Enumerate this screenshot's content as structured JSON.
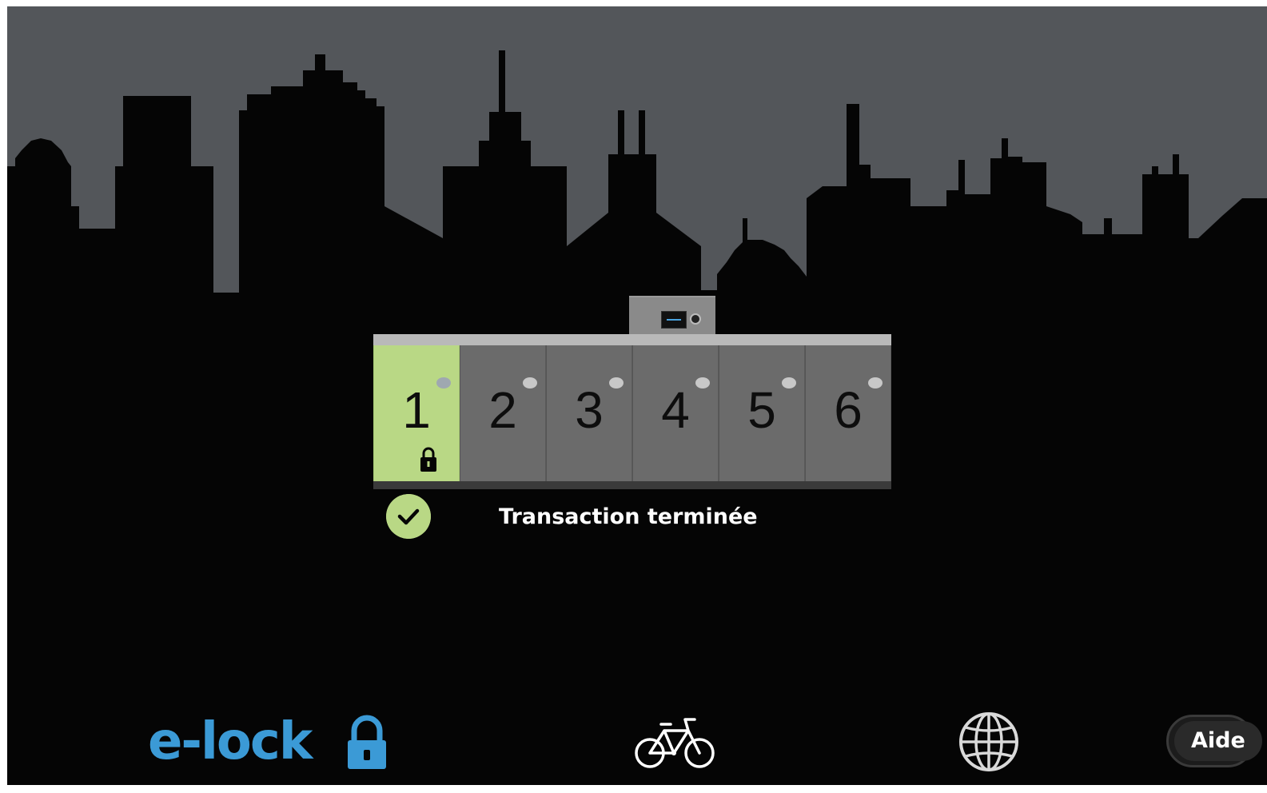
{
  "locker": {
    "doors": [
      {
        "number": "1",
        "state": "selected-locked"
      },
      {
        "number": "2",
        "state": "available"
      },
      {
        "number": "3",
        "state": "available"
      },
      {
        "number": "4",
        "state": "available"
      },
      {
        "number": "5",
        "state": "available"
      },
      {
        "number": "6",
        "state": "available"
      }
    ]
  },
  "status": {
    "icon": "check-icon",
    "message": "Transaction terminée"
  },
  "footer": {
    "logo_text": "e-lock",
    "bike_icon": "bicycle-icon",
    "language_icon": "globe-icon",
    "help_label": "Aide"
  },
  "colors": {
    "background": "#050505",
    "sky": "#53565a",
    "accent_green": "#b9d885",
    "brand_blue": "#3b9ad6",
    "door_gray": "#6b6b6b"
  }
}
